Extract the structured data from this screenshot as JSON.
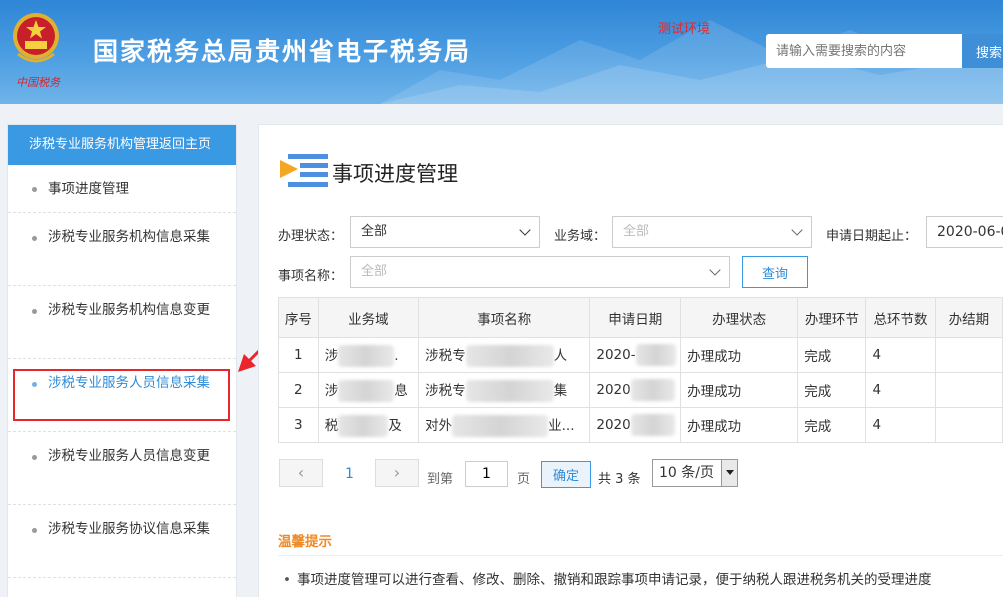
{
  "header": {
    "title": "国家税务总局贵州省电子税务局",
    "emblem_text": "中国税务",
    "env_label": "测试环境",
    "search_placeholder": "请输入需要搜索的内容",
    "search_button": "搜索"
  },
  "sidebar": {
    "header": "涉税专业服务机构管理返回主页",
    "items": [
      {
        "label": "事项进度管理"
      },
      {
        "label": "涉税专业服务机构信息采集"
      },
      {
        "label": "涉税专业服务机构信息变更"
      },
      {
        "label": "涉税专业服务人员信息采集"
      },
      {
        "label": "涉税专业服务人员信息变更"
      },
      {
        "label": "涉税专业服务协议信息采集"
      }
    ]
  },
  "main": {
    "title": "事项进度管理",
    "filters": {
      "status_label": "办理状态：",
      "status_value": "全部",
      "domain_label": "业务域：",
      "domain_value": "全部",
      "date_label": "申请日期起止：",
      "date_value": "2020-06-0",
      "item_label": "事项名称：",
      "item_value": "全部",
      "query_button": "查询"
    },
    "table": {
      "columns": [
        "序号",
        "业务域",
        "事项名称",
        "申请日期",
        "办理状态",
        "办理环节",
        "总环节数",
        "办结期"
      ],
      "rows": [
        {
          "no": "1",
          "domain": "涉",
          "domain_tail": ".",
          "item": "涉税专",
          "item_tail": "人",
          "date": "2020-",
          "status": "办理成功",
          "step": "完成",
          "total": "4"
        },
        {
          "no": "2",
          "domain": "涉",
          "domain_tail": "息",
          "item": "涉税专",
          "item_tail": "集",
          "date": "2020",
          "status": "办理成功",
          "step": "完成",
          "total": "4"
        },
        {
          "no": "3",
          "domain": "税",
          "domain_tail": "及",
          "item": "对外",
          "item_tail": "业...",
          "date": "2020",
          "status": "办理成功",
          "step": "完成",
          "total": "4"
        }
      ]
    },
    "pagination": {
      "prev": "‹",
      "current": "1",
      "next": "›",
      "goto_label": "到第",
      "goto_value": "1",
      "page_unit": "页",
      "confirm": "确定",
      "total": "共 3 条",
      "page_size": "10 条/页"
    },
    "tips": {
      "title": "温馨提示",
      "items": [
        "事项进度管理可以进行查看、修改、删除、撤销和跟踪事项申请记录，便于纳税人跟进税务机关的受理进度"
      ]
    }
  },
  "colors": {
    "header_blue": "#2f86d6",
    "accent": "#3a99e3",
    "highlight_red": "#e8262c",
    "tips_orange": "#f08a24"
  }
}
